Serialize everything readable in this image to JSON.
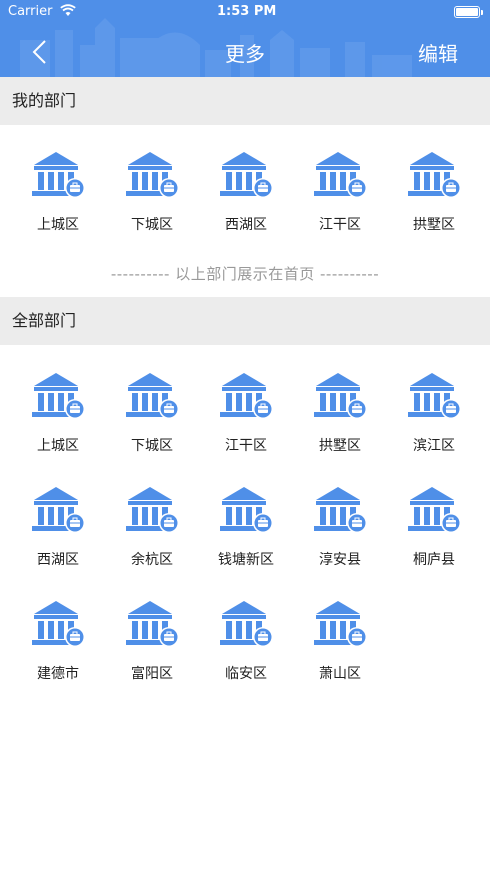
{
  "status_bar": {
    "carrier": "Carrier",
    "time": "1:53 PM"
  },
  "nav": {
    "title": "更多",
    "edit_label": "编辑"
  },
  "colors": {
    "accent": "#4f8fe8",
    "header_bg": "#ececec",
    "hint_text": "#999999"
  },
  "my_departments": {
    "title": "我的部门",
    "items": [
      "上城区",
      "下城区",
      "西湖区",
      "江干区",
      "拱墅区"
    ]
  },
  "divider_text": "---------- 以上部门展示在首页 ----------",
  "all_departments": {
    "title": "全部部门",
    "items": [
      "上城区",
      "下城区",
      "江干区",
      "拱墅区",
      "滨江区",
      "西湖区",
      "余杭区",
      "钱塘新区",
      "淳安县",
      "桐庐县",
      "建德市",
      "富阳区",
      "临安区",
      "萧山区"
    ]
  },
  "icon": "government-building-icon"
}
